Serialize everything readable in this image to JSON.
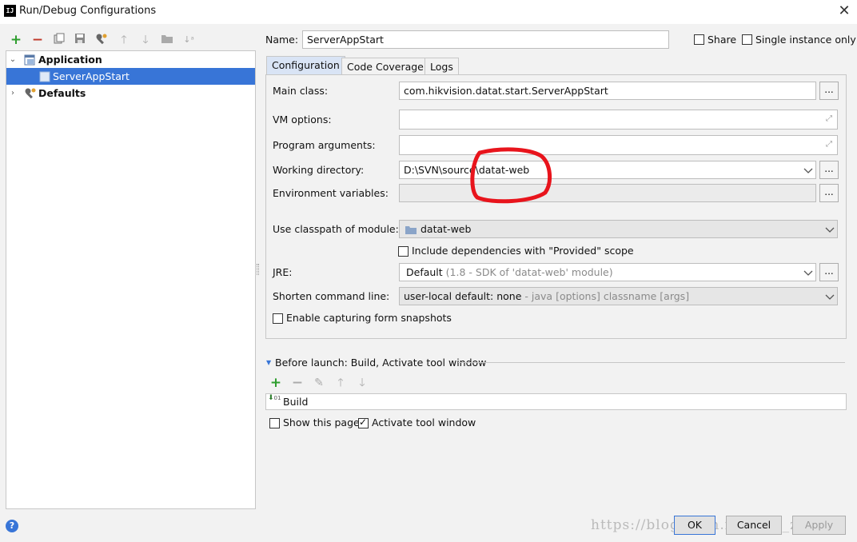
{
  "window": {
    "title": "Run/Debug Configurations"
  },
  "tree": {
    "group": "Application",
    "item": "ServerAppStart",
    "defaults": "Defaults"
  },
  "form": {
    "name_label": "Name:",
    "name_value": "ServerAppStart",
    "share_label": "Share",
    "single_instance_label": "Single instance only",
    "tabs": [
      "Configuration",
      "Code Coverage",
      "Logs"
    ],
    "main_class_label": "Main class:",
    "main_class_value": "com.hikvision.datat.start.ServerAppStart",
    "vm_options_label": "VM options:",
    "program_args_label": "Program arguments:",
    "working_dir_label": "Working directory:",
    "working_dir_value": "D:\\SVN\\source\\datat-web",
    "env_vars_label": "Environment variables:",
    "classpath_label": "Use classpath of module:",
    "classpath_value": "datat-web",
    "include_deps_label": "Include dependencies with \"Provided\" scope",
    "jre_label": "JRE:",
    "jre_value": "Default",
    "jre_hint": "(1.8 - SDK of 'datat-web' module)",
    "shorten_label": "Shorten command line:",
    "shorten_value": "user-local default: none",
    "shorten_hint": "- java [options] classname [args]",
    "capture_label": "Enable capturing form snapshots",
    "ellipsis": "..."
  },
  "before_launch": {
    "title": "Before launch: Build, Activate tool window",
    "task": "Build",
    "show_page_label": "Show this page",
    "activate_label": "Activate tool window"
  },
  "buttons": {
    "ok": "OK",
    "cancel": "Cancel",
    "apply": "Apply",
    "help": "?"
  },
  "watermark": "https://blog.csdn.net/yu0_zhang0",
  "colors": {
    "accent": "#3875d7",
    "add": "#2e9e2e",
    "remove": "#c0392b",
    "annotation": "#e8141c"
  }
}
